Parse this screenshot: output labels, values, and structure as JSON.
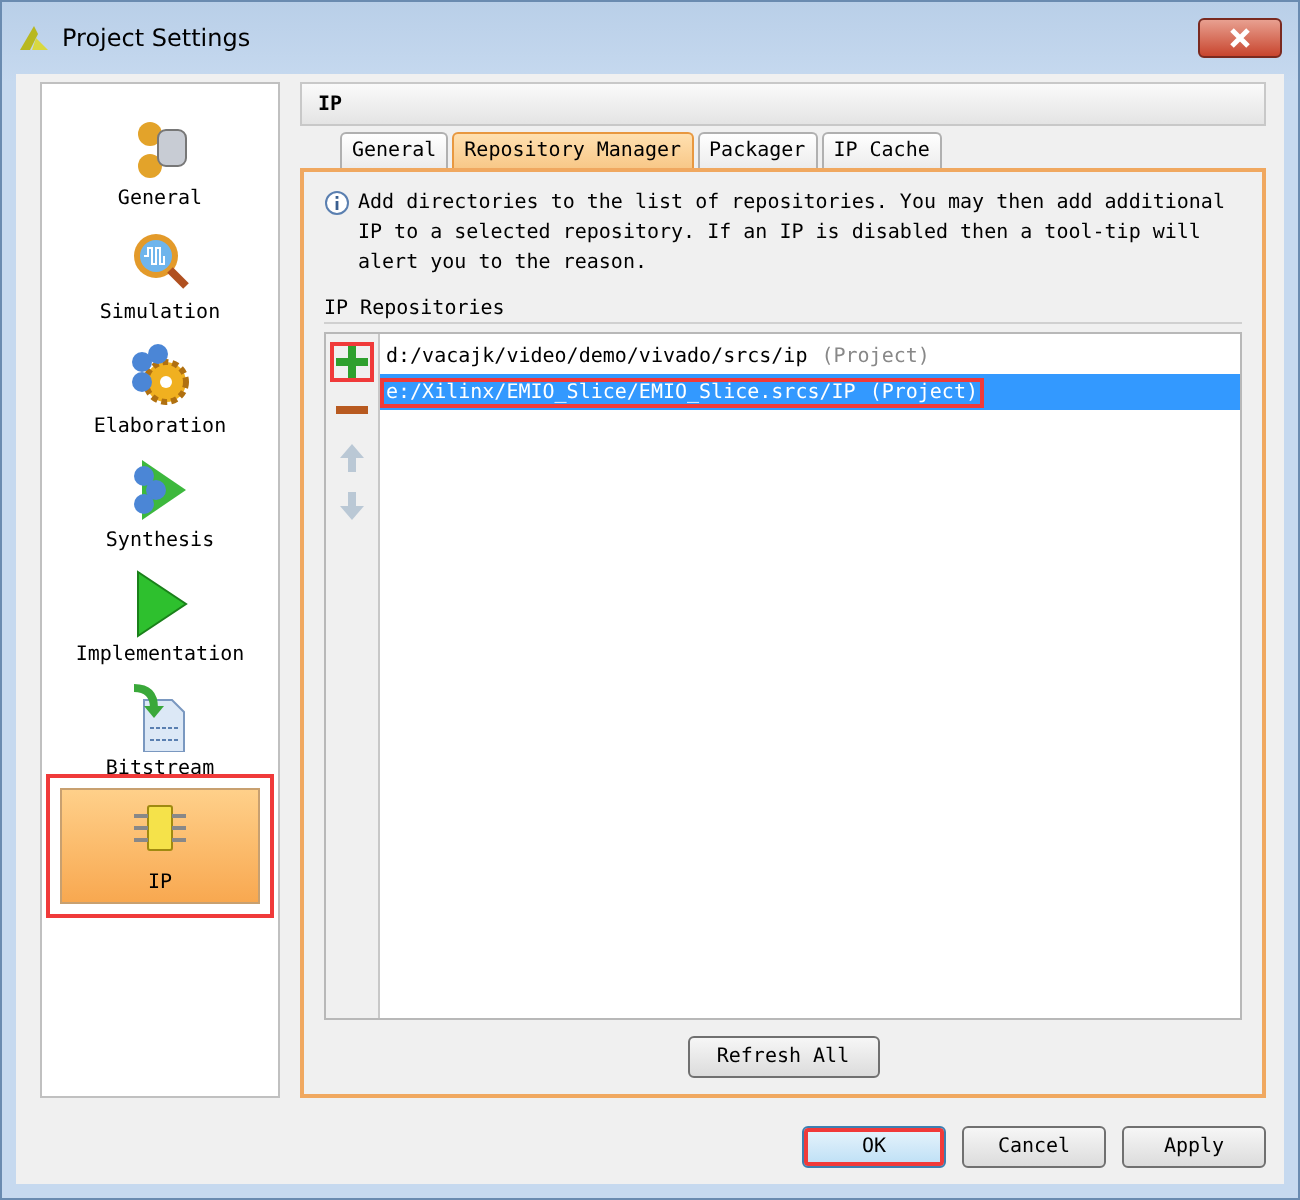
{
  "window": {
    "title": "Project Settings"
  },
  "sidebar": {
    "items": [
      {
        "label": "General",
        "selected": false,
        "highlighted": false
      },
      {
        "label": "Simulation",
        "selected": false,
        "highlighted": false
      },
      {
        "label": "Elaboration",
        "selected": false,
        "highlighted": false
      },
      {
        "label": "Synthesis",
        "selected": false,
        "highlighted": false
      },
      {
        "label": "Implementation",
        "selected": false,
        "highlighted": false
      },
      {
        "label": "Bitstream",
        "selected": false,
        "highlighted": false
      },
      {
        "label": "IP",
        "selected": true,
        "highlighted": true
      }
    ]
  },
  "panel": {
    "title": "IP",
    "tabs": [
      {
        "label": "General",
        "selected": false
      },
      {
        "label": "Repository Manager",
        "selected": true
      },
      {
        "label": "Packager",
        "selected": false
      },
      {
        "label": "IP Cache",
        "selected": false
      }
    ],
    "info": "Add directories to the list of repositories. You may then add additional IP to a selected repository. If an IP is disabled then a tool-tip will alert you to the reason.",
    "section_label": "IP Repositories",
    "tools": [
      {
        "kind": "add",
        "disabled": false,
        "highlighted": true
      },
      {
        "kind": "remove",
        "disabled": false,
        "highlighted": false
      },
      {
        "kind": "up",
        "disabled": true,
        "highlighted": false
      },
      {
        "kind": "down",
        "disabled": true,
        "highlighted": false
      }
    ],
    "repositories": [
      {
        "path": "d:/vacajk/video/demo/vivado/srcs/ip",
        "tag": "(Project)",
        "selected": false,
        "highlighted": false
      },
      {
        "path": "e:/Xilinx/EMIO_Slice/EMIO_Slice.srcs/IP",
        "tag": "(Project)",
        "selected": true,
        "highlighted": true
      }
    ],
    "refresh_button": "Refresh All"
  },
  "buttons": [
    {
      "label": "OK",
      "default": true,
      "highlighted": true
    },
    {
      "label": "Cancel",
      "default": false,
      "highlighted": false
    },
    {
      "label": "Apply",
      "default": false,
      "highlighted": false
    }
  ]
}
